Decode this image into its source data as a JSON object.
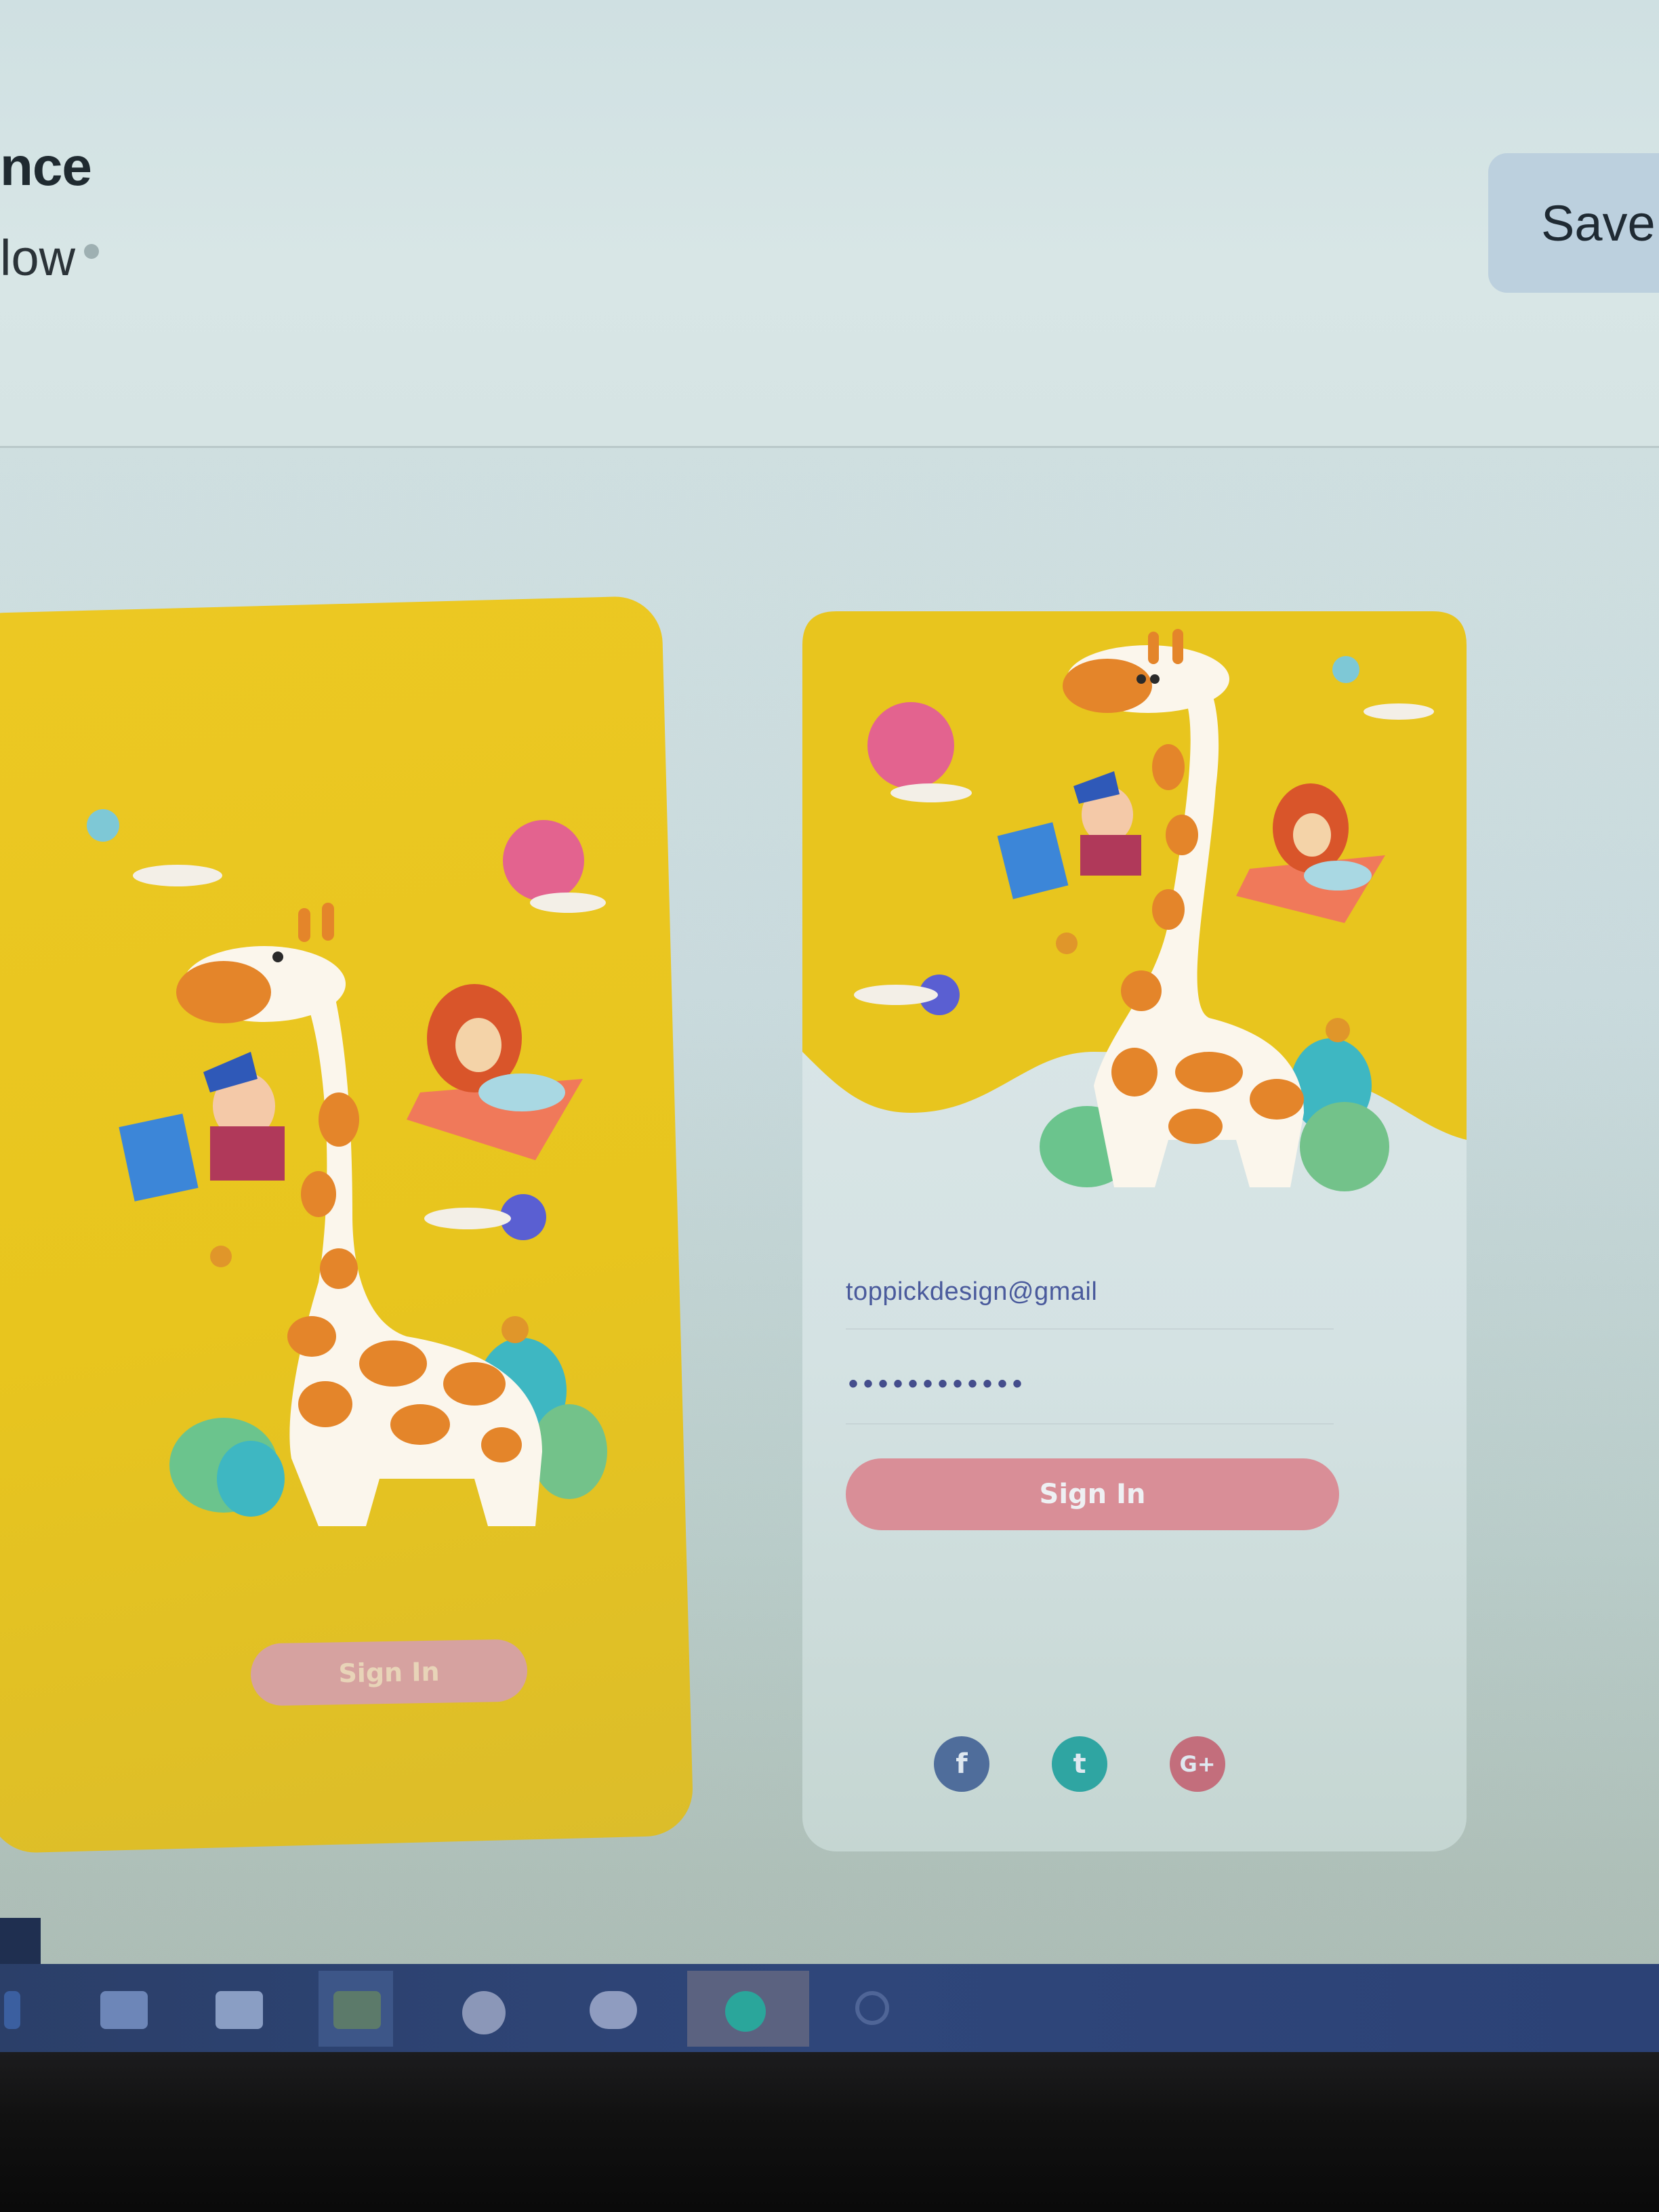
{
  "header": {
    "title": "nce",
    "subtitle": "low",
    "save_label": "Save"
  },
  "left_screen": {
    "sign_in_label": "Sign In"
  },
  "right_screen": {
    "email_value": "toppickdesign@gmail",
    "password_mask": "••••••••••••",
    "sign_in_label": "Sign In",
    "social": [
      {
        "name": "facebook",
        "glyph": "f"
      },
      {
        "name": "twitter",
        "glyph": "t"
      },
      {
        "name": "google-plus",
        "glyph": "G+"
      }
    ]
  },
  "colors": {
    "card_yellow": "#e8c51e",
    "sign_in_pink": "#d98e97",
    "facebook": "#4f6d9b",
    "twitter": "#2fa5a2",
    "google": "#c36e7c"
  },
  "taskbar": {
    "icons": [
      "start-icon",
      "task-view-icon",
      "file-explorer-icon",
      "store-icon",
      "chat-icon",
      "mail-icon",
      "app-icon",
      "search-icon"
    ]
  }
}
